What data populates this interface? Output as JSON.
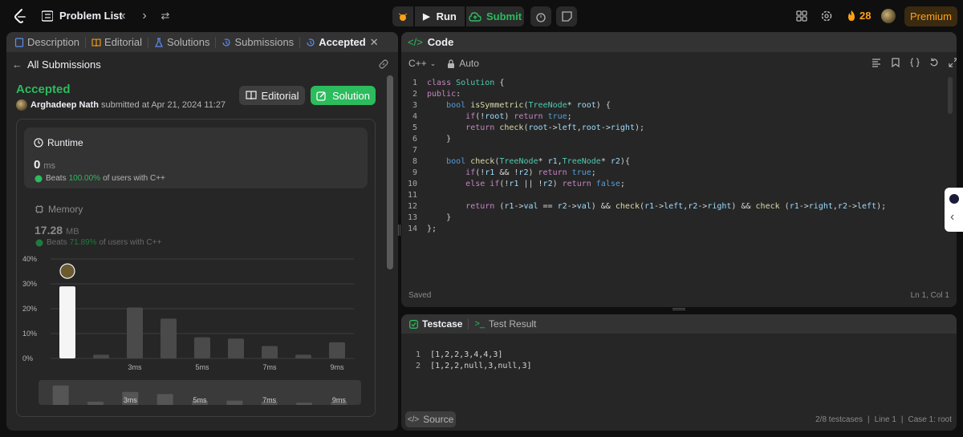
{
  "header": {
    "problem_list": "Problem List",
    "run": "Run",
    "submit": "Submit",
    "streak_count": "28",
    "premium": "Premium"
  },
  "left_panel": {
    "tabs": [
      {
        "label": "Description"
      },
      {
        "label": "Editorial"
      },
      {
        "label": "Solutions"
      },
      {
        "label": "Submissions"
      },
      {
        "label": "Accepted"
      }
    ],
    "back_label": "All Submissions",
    "status": "Accepted",
    "author": "Arghadeep Nath",
    "submitted_text": "submitted at Apr 21, 2024 11:27",
    "editorial_btn": "Editorial",
    "solution_btn": "Solution",
    "runtime": {
      "title": "Runtime",
      "value": "0",
      "unit": "ms",
      "beats_label": "Beats",
      "beats_pct": "100.00%",
      "beats_suffix": "of users with C++"
    },
    "memory": {
      "title": "Memory",
      "value": "17.28",
      "unit": "MB",
      "beats_label": "Beats",
      "beats_pct": "71.89%",
      "beats_suffix": "of users with C++"
    }
  },
  "chart_data": {
    "type": "bar",
    "ylim": [
      0,
      40
    ],
    "yticks": [
      "40%",
      "30%",
      "20%",
      "10%",
      "0%"
    ],
    "x_tick_labels": [
      "3ms",
      "5ms",
      "7ms",
      "9ms"
    ],
    "values": [
      29,
      1.5,
      20.5,
      16,
      8.5,
      8,
      5,
      1.5,
      6.5
    ],
    "highlight_index": 0,
    "minimap_values": [
      9,
      1.5,
      6,
      5,
      2,
      2,
      1.5,
      1,
      1.5
    ],
    "minimap_tick_labels": [
      "3ms",
      "5ms",
      "7ms",
      "9ms"
    ]
  },
  "code_panel": {
    "title": "Code",
    "language": "C++",
    "mode": "Auto",
    "saved": "Saved",
    "cursor": "Ln 1, Col 1",
    "lines": [
      "class Solution {",
      "public:",
      "    bool isSymmetric(TreeNode* root) {",
      "        if(!root) return true;",
      "        return check(root->left,root->right);",
      "    }",
      "",
      "    bool check(TreeNode* r1,TreeNode* r2){",
      "        if(!r1 && !r2) return true;",
      "        else if(!r1 || !r2) return false;",
      "",
      "        return (r1->val == r2->val) && check(r1->left,r2->right) && check (r1->right,r2->left);",
      "    }",
      "};"
    ]
  },
  "testcase_panel": {
    "tab_testcase": "Testcase",
    "tab_result": "Test Result",
    "inputs": [
      "[1,2,2,3,4,4,3]",
      "[1,2,2,null,3,null,3]"
    ],
    "source_btn": "Source",
    "count": "2/8 testcases",
    "line": "Line 1",
    "case": "Case 1: root"
  }
}
